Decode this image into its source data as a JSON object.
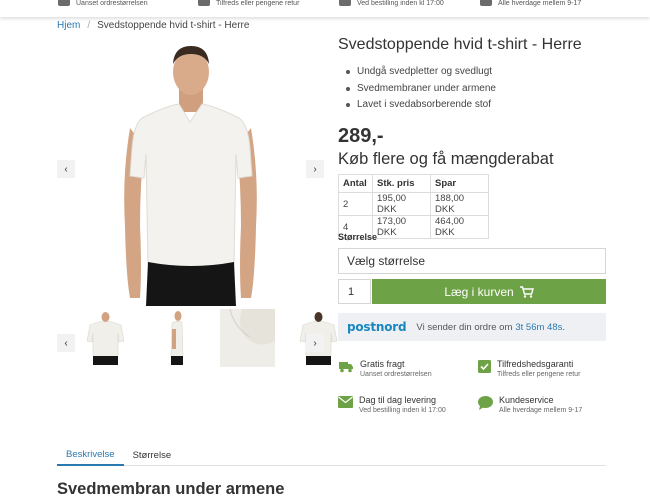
{
  "top_bar": {
    "items": [
      {
        "sub": "Uanset ordrestørrelsen",
        "icon": "truck-icon"
      },
      {
        "sub": "Tilfreds eller pengene retur",
        "icon": "check-icon"
      },
      {
        "sub": "Ved bestilling inden kl 17:00",
        "icon": "mail-icon"
      },
      {
        "sub": "Alle hverdage mellem 9-17",
        "icon": "chat-icon"
      }
    ]
  },
  "breadcrumb": {
    "home": "Hjem",
    "separator": "/",
    "current": "Svedstoppende hvid t-shirt - Herre"
  },
  "gallery": {
    "prev": "‹",
    "next": "›"
  },
  "product": {
    "title": "Svedstoppende hvid t-shirt - Herre",
    "bullets": [
      "Undgå svedpletter og svedlugt",
      "Svedmembraner under armene",
      "Lavet i svedabsorberende stof"
    ],
    "price": "289,-"
  },
  "bulk": {
    "title": "Køb flere og få mængderabat",
    "headers": [
      "Antal",
      "Stk. pris",
      "Spar"
    ],
    "rows": [
      [
        "2",
        "195,00 DKK",
        "188,00 DKK"
      ],
      [
        "4",
        "173,00 DKK",
        "464,00 DKK"
      ]
    ]
  },
  "size": {
    "label": "Størrelse",
    "placeholder": "Vælg størrelse"
  },
  "cart": {
    "quantity": "1",
    "button": "Læg i kurven"
  },
  "delivery": {
    "brand": "postnord",
    "text": "Vi sender din ordre om",
    "countdown": "3t 56m 48s",
    "period": "."
  },
  "usps": [
    {
      "title": "Gratis fragt",
      "sub": "Uanset ordrestørrelsen",
      "icon": "truck-icon"
    },
    {
      "title": "Tilfredshedsgaranti",
      "sub": "Tilfreds eller pengene retur",
      "icon": "check-icon"
    },
    {
      "title": "Dag til dag levering",
      "sub": "Ved bestilling inden kl 17:00",
      "icon": "mail-icon"
    },
    {
      "title": "Kundeservice",
      "sub": "Alle hverdage mellem 9-17",
      "icon": "chat-icon"
    }
  ],
  "tabs": [
    "Beskrivelse",
    "Størrelse"
  ],
  "section_heading": "Svedmembran under armene",
  "colors": {
    "accent": "#6ea246",
    "link": "#2a7ab0",
    "postnord": "#1a87c0",
    "icon": "#6ea246"
  }
}
